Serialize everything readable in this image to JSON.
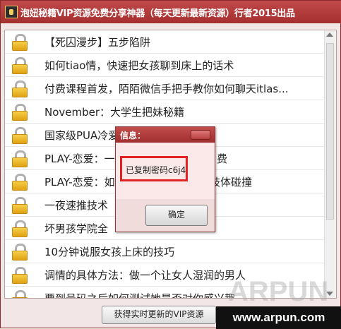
{
  "window": {
    "title": "泡妞秘籍VIP资源免费分享神器（每天更新最新资源）行者2015出品"
  },
  "list": {
    "items": [
      {
        "text": "【死囚漫步】五步陷阱"
      },
      {
        "text": "如何tiao情，快速把女孩聊到床上的话术"
      },
      {
        "text": "付费课程首发，陌陌微信手把手教你如何聊天itlas..."
      },
      {
        "text": "November：大学生把妹秘籍"
      },
      {
        "text": "国家级PUA冷爱"
      },
      {
        "text": "PLAY-恋爱：一"
      },
      {
        "text": "PLAY-恋爱：如"
      },
      {
        "text": "一夜速推技术"
      },
      {
        "text": "坏男孩学院全"
      },
      {
        "text": "10分钟说服女孩上床的技巧"
      },
      {
        "text": "调情的具体方法：做一个让女人湿润的男人"
      },
      {
        "text": "要到号码之后如何测试她是否对你感兴趣"
      }
    ],
    "row_tail_5": "费",
    "row_tail_6": "肢体碰撞"
  },
  "bottom": {
    "button_label": "获得实时更新的VIP资源",
    "watermark": "ARPUN",
    "url": "www.arpun.com"
  },
  "dialog": {
    "title": "信息：",
    "message": "已复制密码c6j4",
    "ok_label": "确定"
  }
}
